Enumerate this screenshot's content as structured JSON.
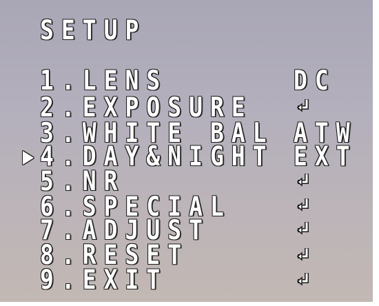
{
  "menu": {
    "title": "SETUP",
    "items": [
      {
        "label": "1.LENS",
        "value": "DC",
        "submenu": false
      },
      {
        "label": "2.EXPOSURE",
        "value": "",
        "submenu": true
      },
      {
        "label": "3.WHITE BAL",
        "value": "ATW",
        "submenu": false
      },
      {
        "label": "4.DAY&NIGHT",
        "value": "EXT",
        "submenu": false,
        "selected": true
      },
      {
        "label": "5.NR",
        "value": "",
        "submenu": true
      },
      {
        "label": "6.SPECIAL",
        "value": "",
        "submenu": true
      },
      {
        "label": "7.ADJUST",
        "value": "",
        "submenu": true
      },
      {
        "label": "8.RESET",
        "value": "",
        "submenu": true
      },
      {
        "label": "9.EXIT",
        "value": "",
        "submenu": true
      }
    ],
    "cursor_icon": "triangle-right-icon",
    "submenu_icon": "enter-arrow-icon"
  }
}
